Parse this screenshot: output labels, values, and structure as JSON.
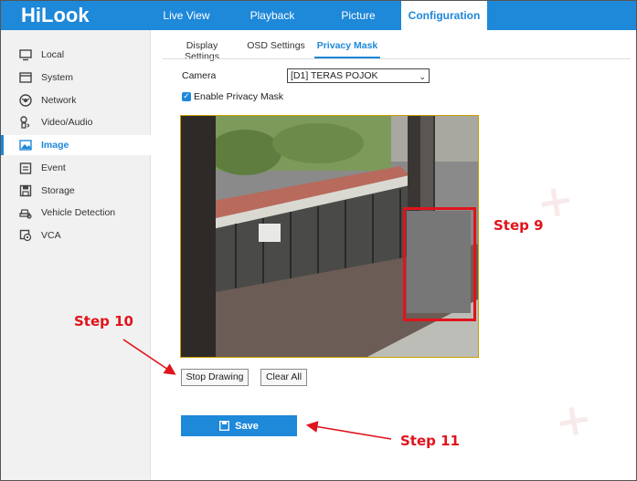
{
  "app": {
    "logo": "HiLook"
  },
  "nav": {
    "tabs": [
      {
        "label": "Live View"
      },
      {
        "label": "Playback"
      },
      {
        "label": "Picture"
      },
      {
        "label": "Configuration"
      }
    ]
  },
  "sidebar": {
    "items": [
      {
        "label": "Local",
        "icon": "monitor-icon"
      },
      {
        "label": "System",
        "icon": "system-icon"
      },
      {
        "label": "Network",
        "icon": "globe-icon"
      },
      {
        "label": "Video/Audio",
        "icon": "video-audio-icon"
      },
      {
        "label": "Image",
        "icon": "image-icon"
      },
      {
        "label": "Event",
        "icon": "calendar-icon"
      },
      {
        "label": "Storage",
        "icon": "storage-icon"
      },
      {
        "label": "Vehicle Detection",
        "icon": "vehicle-detection-icon"
      },
      {
        "label": "VCA",
        "icon": "vca-icon"
      }
    ]
  },
  "subtabs": [
    {
      "label": "Display Settings"
    },
    {
      "label": "OSD Settings"
    },
    {
      "label": "Privacy Mask"
    }
  ],
  "form": {
    "camera_label": "Camera",
    "camera_value": "[D1] TERAS POJOK",
    "enable_label": "Enable Privacy Mask"
  },
  "buttons": {
    "stop_drawing": "Stop Drawing",
    "clear_all": "Clear All",
    "save": "Save"
  },
  "annotations": {
    "step9": "Step 9",
    "step10": "Step 10",
    "step11": "Step 11"
  },
  "colors": {
    "brand": "#1e88d9",
    "annotation_red": "#e0141c"
  }
}
